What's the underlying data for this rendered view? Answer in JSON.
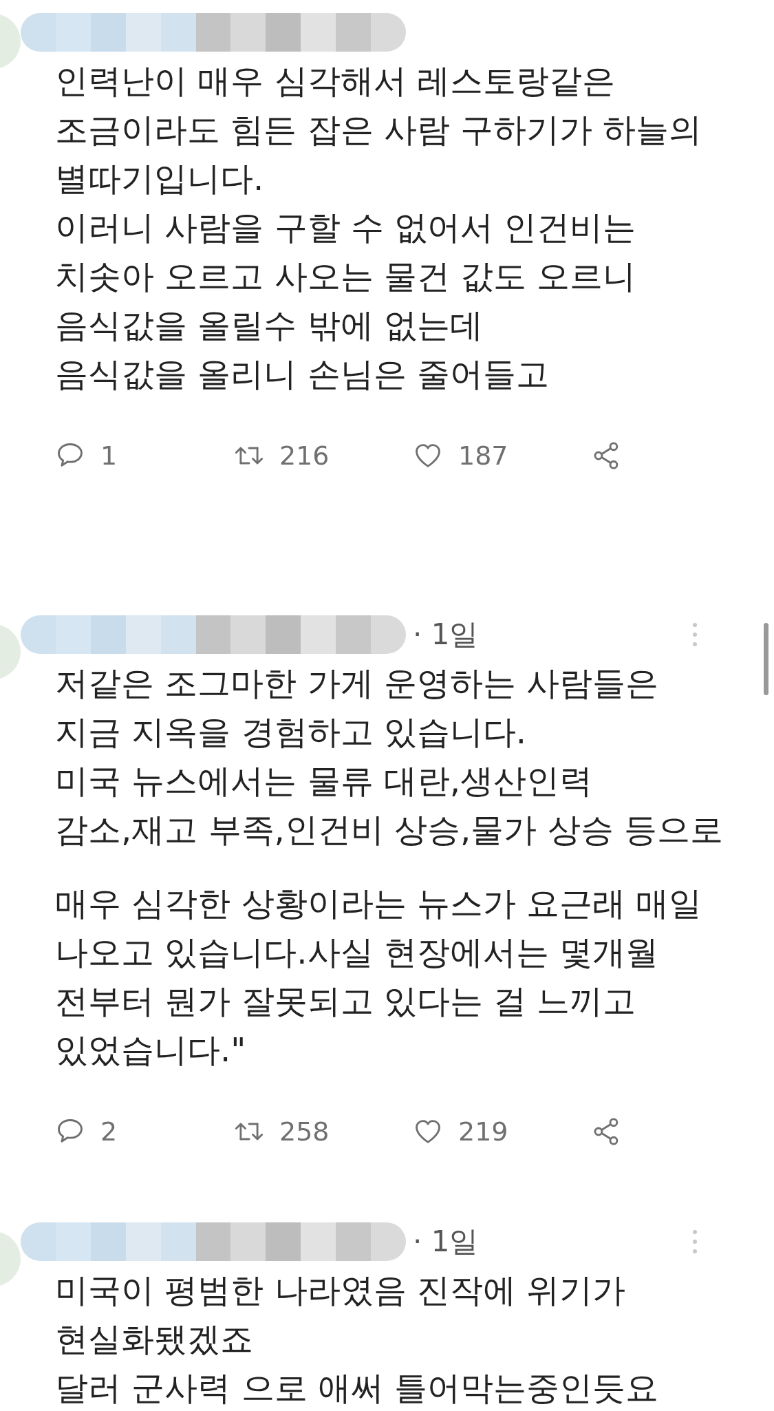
{
  "posts": [
    {
      "paragraphs": [
        [
          "인력난이 매우 심각해서 레스토랑같은",
          "조금이라도 힘든 잡은 사람 구하기가 하늘의",
          "별따기입니다.",
          "이러니 사람을 구할 수 없어서 인건비는",
          "치솟아 오르고 사오는 물건 값도 오르니",
          "음식값을 올릴수 밖에 없는데",
          "음식값을 올리니 손님은 줄어들고"
        ]
      ],
      "actions": [
        {
          "kind": "reply",
          "count": "1"
        },
        {
          "kind": "retweet",
          "count": "216"
        },
        {
          "kind": "like",
          "count": "187"
        },
        {
          "kind": "share"
        }
      ]
    },
    {
      "time": "· 1일",
      "paragraphs": [
        [
          "저같은 조그마한 가게 운영하는 사람들은",
          "지금 지옥을 경험하고 있습니다.",
          "미국 뉴스에서는 물류 대란,생산인력",
          "감소,재고 부족,인건비 상승,물가 상승 등으로"
        ],
        [
          "매우 심각한 상황이라는 뉴스가 요근래 매일",
          "나오고 있습니다.사실 현장에서는 몇개월",
          "전부터 뭔가 잘못되고 있다는 걸 느끼고",
          "있었습니다.\""
        ]
      ],
      "actions": [
        {
          "kind": "reply",
          "count": "2"
        },
        {
          "kind": "retweet",
          "count": "258"
        },
        {
          "kind": "like",
          "count": "219"
        },
        {
          "kind": "share"
        }
      ]
    },
    {
      "time": "· 1일",
      "paragraphs": [
        [
          "미국이 평범한 나라였음 진작에 위기가",
          "현실화됐겠죠",
          "달러 군사력 으로 애써 틀어막는중인듯요"
        ]
      ]
    }
  ]
}
